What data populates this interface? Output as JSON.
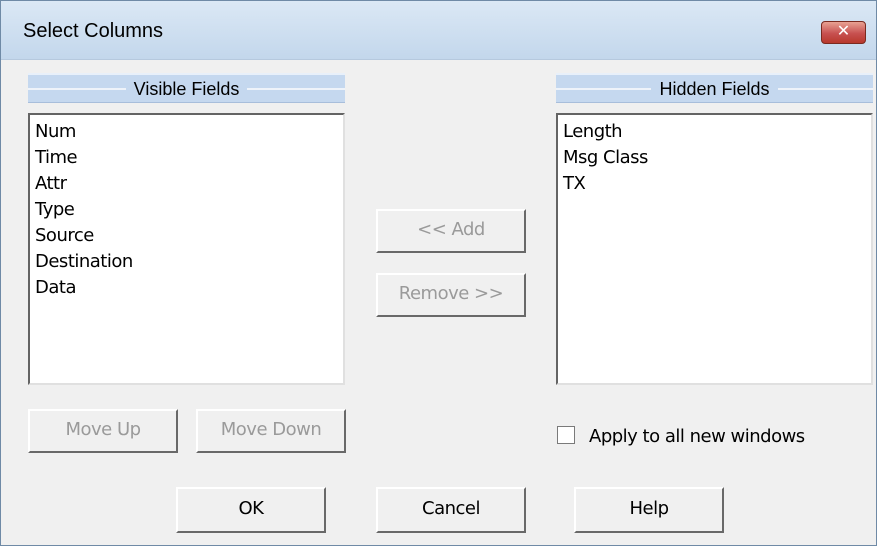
{
  "dialog": {
    "title": "Select Columns",
    "close_label": "✕"
  },
  "visible_panel": {
    "header": "Visible Fields",
    "items": [
      "Num",
      "Time",
      "Attr",
      "Type",
      "Source",
      "Destination",
      "Data"
    ]
  },
  "hidden_panel": {
    "header": "Hidden Fields",
    "items": [
      "Length",
      "Msg Class",
      "TX"
    ]
  },
  "buttons": {
    "add": "<< Add",
    "remove": "Remove >>",
    "move_up": "Move Up",
    "move_down": "Move Down",
    "ok": "OK",
    "cancel": "Cancel",
    "help": "Help"
  },
  "apply_checkbox": {
    "label": "Apply to all new windows",
    "checked": false
  },
  "colors": {
    "title_bar": "#c3d7ec",
    "header_band": "#c5d8ef",
    "close_button": "#c75050",
    "dialog_bg": "#f0f0f0",
    "disabled_text": "#9a9a9a"
  }
}
